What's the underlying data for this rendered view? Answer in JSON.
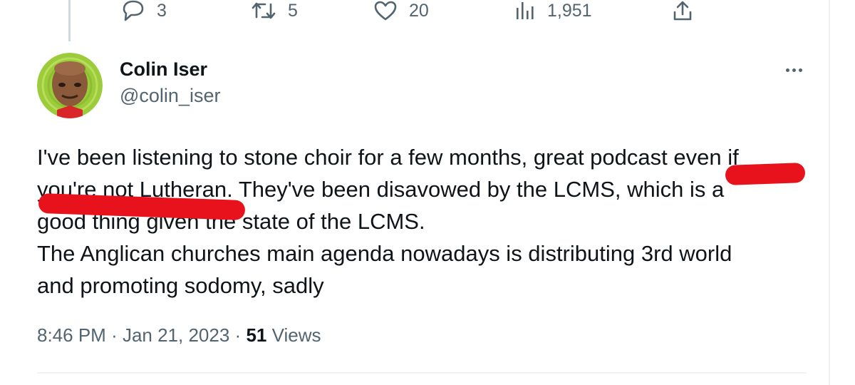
{
  "actions": {
    "replies": "3",
    "retweets": "5",
    "likes": "20",
    "views": "1,951"
  },
  "author": {
    "name": "Colin Iser",
    "handle": "@colin_iser"
  },
  "tweet": {
    "line1": "I've been listening to stone choir for a few months, great podcast even if",
    "line2": "you're not Lutheran. They've been disavowed by the LCMS, which is a",
    "line3": "good thing given the state of the LCMS.",
    "line4": "The Anglican churches main agenda nowadays is distributing 3rd world",
    "line5": "and promoting sodomy, sadly"
  },
  "meta": {
    "time": "8:46 PM",
    "date": "Jan 21, 2023",
    "views_count": "51",
    "views_label": "Views"
  },
  "icons": {
    "reply": "reply-bubble-icon",
    "retweet": "retweet-icon",
    "like": "heart-icon",
    "views": "bar-chart-icon",
    "share": "share-upload-icon",
    "more": "more-dots-icon"
  },
  "colors": {
    "text": "#0f1419",
    "secondary": "#536471",
    "redaction": "#e8121c",
    "avatar_ring": "#9ccc3c"
  }
}
